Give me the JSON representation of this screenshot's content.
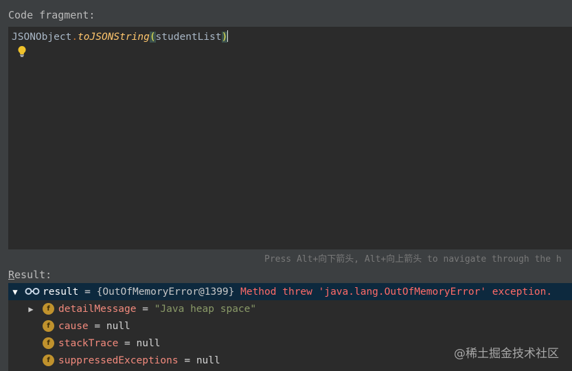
{
  "labels": {
    "code_fragment": "Code fragment:",
    "result_mnemonic": "R",
    "result_rest": "esult:"
  },
  "editor": {
    "class_name": "JSONObject",
    "dot": ".",
    "method": "toJSONString",
    "open_paren": "(",
    "argument": "studentList",
    "close_paren": ")",
    "hint_icon": "lightbulb-icon"
  },
  "hint_text": "Press Alt+向下箭头, Alt+向上箭头 to navigate through the h",
  "result": {
    "root": {
      "name": "result",
      "eq": " = ",
      "object_ref": "{OutOfMemoryError@1399}",
      "message": " Method threw 'java.lang.OutOfMemoryError' exception.",
      "icon": "watch-glasses-icon"
    },
    "fields": [
      {
        "badge": "f",
        "name": "detailMessage",
        "eq": " = ",
        "value": "\"Java heap space\"",
        "type": "string",
        "expandable": true
      },
      {
        "badge": "f",
        "name": "cause",
        "eq": " = ",
        "value": "null",
        "type": "null",
        "expandable": false
      },
      {
        "badge": "f",
        "name": "stackTrace",
        "eq": " = ",
        "value": "null",
        "type": "null",
        "expandable": false
      },
      {
        "badge": "f",
        "name": "suppressedExceptions",
        "eq": " = ",
        "value": "null",
        "type": "null",
        "expandable": false
      }
    ]
  },
  "watermark": "@稀土掘金技术社区",
  "colors": {
    "background": "#3c3f41",
    "editor_bg": "#2b2b2b",
    "selection": "#0d293e",
    "field_name": "#f28a7d",
    "error": "#ff6b68",
    "string": "#8a9a68",
    "badge": "#c0922d"
  }
}
